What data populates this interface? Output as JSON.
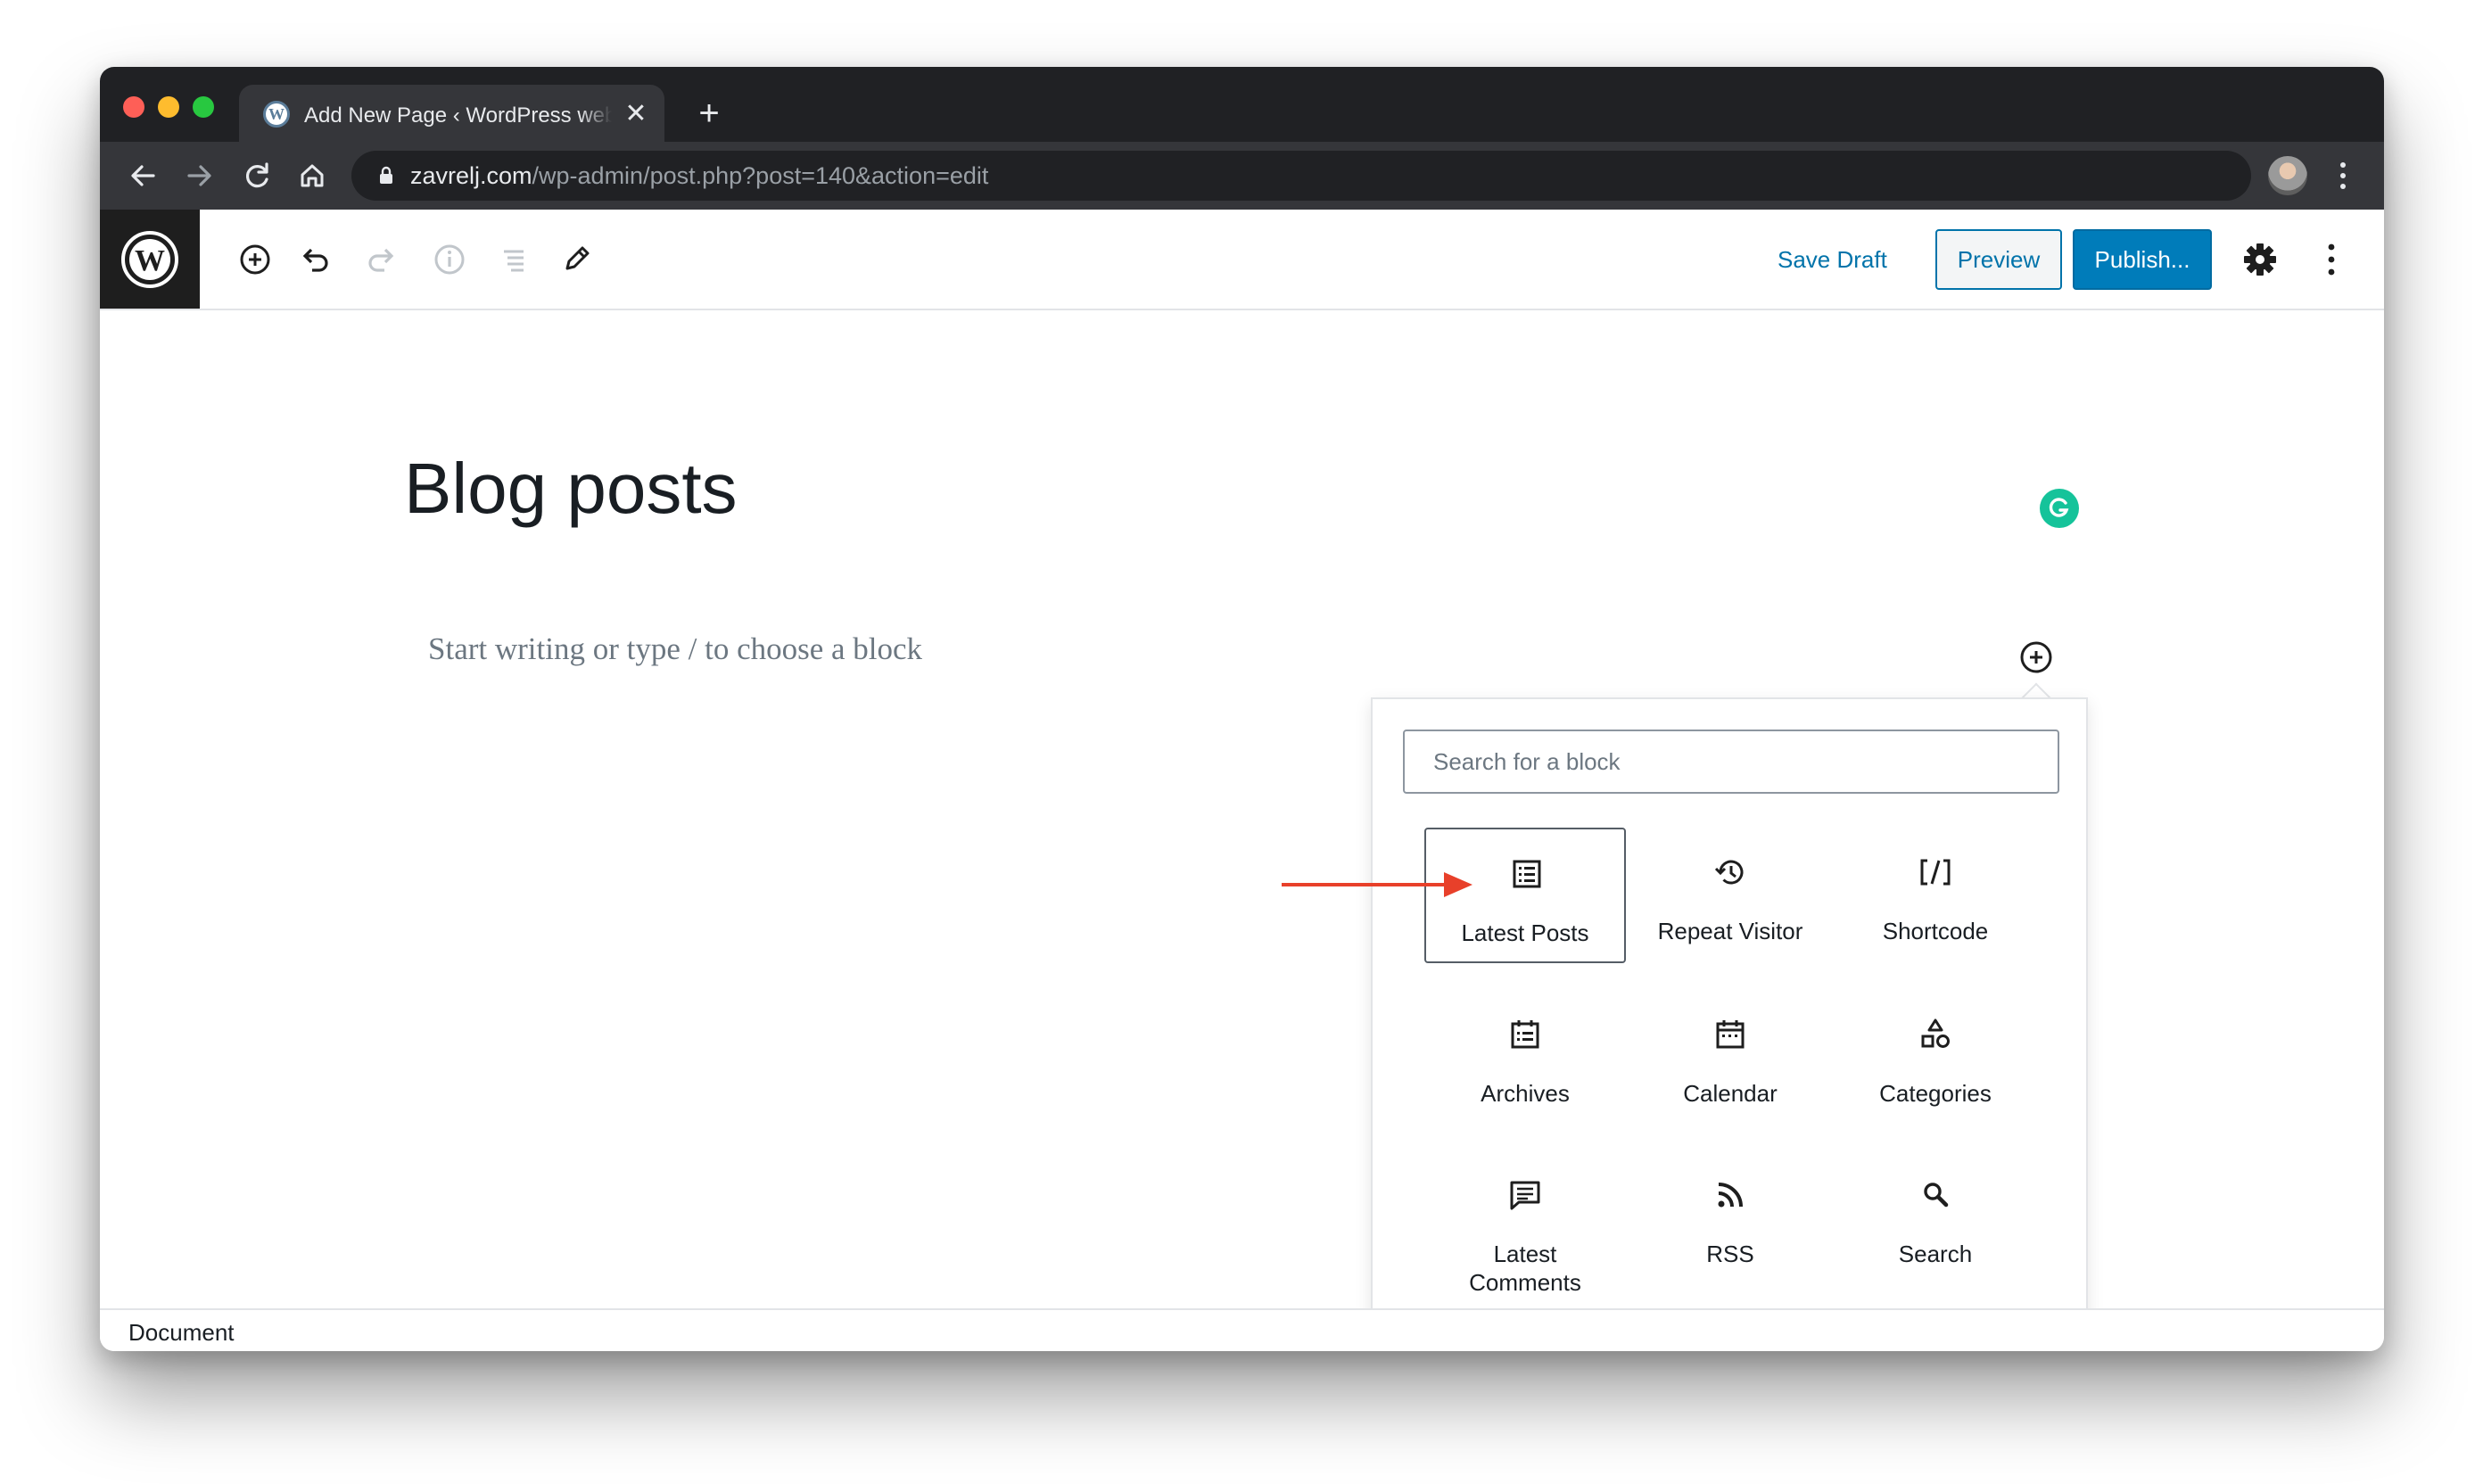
{
  "browser": {
    "tab_title": "Add New Page ‹ WordPress website",
    "tab_close": "✕",
    "new_tab": "+",
    "url_host": "zavrelj.com",
    "url_path": "/wp-admin/post.php?post=140&action=edit",
    "icons": [
      "back-icon",
      "forward-icon",
      "reload-icon",
      "home-icon",
      "lock-icon",
      "star-icon",
      "kebab-icon"
    ]
  },
  "wp": {
    "logo": "W",
    "save_draft": "Save Draft",
    "preview": "Preview",
    "publish": "Publish...",
    "icons": [
      "add-block-icon",
      "undo-icon",
      "redo-icon",
      "info-icon",
      "outline-icon",
      "edit-icon",
      "gear-icon",
      "more-icon"
    ]
  },
  "editor": {
    "title": "Blog posts",
    "placeholder": "Start writing or type / to choose a block"
  },
  "inserter": {
    "search_placeholder": "Search for a block",
    "blocks": [
      {
        "label": "Latest Posts",
        "icon": "list-icon",
        "selected": true
      },
      {
        "label": "Repeat Visitor",
        "icon": "history-icon",
        "selected": false
      },
      {
        "label": "Shortcode",
        "icon": "shortcode-icon",
        "selected": false
      },
      {
        "label": "Archives",
        "icon": "archives-icon",
        "selected": false
      },
      {
        "label": "Calendar",
        "icon": "calendar-icon",
        "selected": false
      },
      {
        "label": "Categories",
        "icon": "categories-icon",
        "selected": false
      },
      {
        "label": "Latest Comments",
        "icon": "comments-icon",
        "selected": false
      },
      {
        "label": "RSS",
        "icon": "rss-icon",
        "selected": false
      },
      {
        "label": "Search",
        "icon": "search-icon",
        "selected": false
      }
    ]
  },
  "footer": {
    "label": "Document"
  },
  "colors": {
    "accent": "#007cba",
    "link": "#0073aa",
    "grammarly": "#15c39a",
    "arrow": "#e8402a"
  }
}
